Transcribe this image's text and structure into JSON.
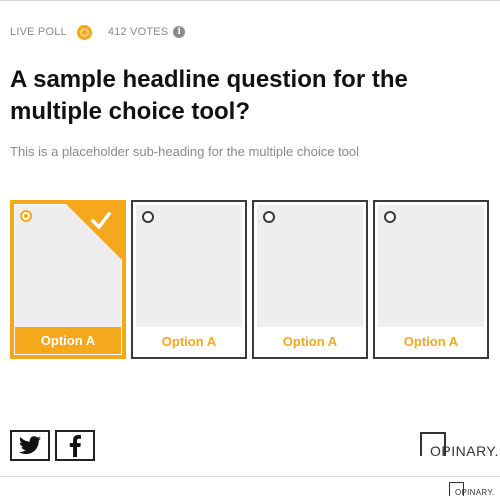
{
  "poll": {
    "live_label": "LIVE POLL",
    "votes_label": "412 VOTES",
    "info_icon": "info-icon",
    "headline": "A sample headline question for the multiple choice tool?",
    "subheading": "This is a placeholder sub-heading for the multiple choice tool",
    "options": [
      {
        "label": "Option A",
        "selected": true
      },
      {
        "label": "Option A",
        "selected": false
      },
      {
        "label": "Option A",
        "selected": false
      },
      {
        "label": "Option A",
        "selected": false
      }
    ]
  },
  "share": {
    "twitter_icon": "twitter-icon",
    "facebook_icon": "facebook-icon"
  },
  "brand": {
    "logo_text": "OPINARY.",
    "footer_logo_text": "OPINARY."
  },
  "colors": {
    "accent": "#f5a81c",
    "text": "#111111",
    "muted": "#8a8a8a",
    "border": "#3a3a3a",
    "image_placeholder": "#eeeeee"
  }
}
